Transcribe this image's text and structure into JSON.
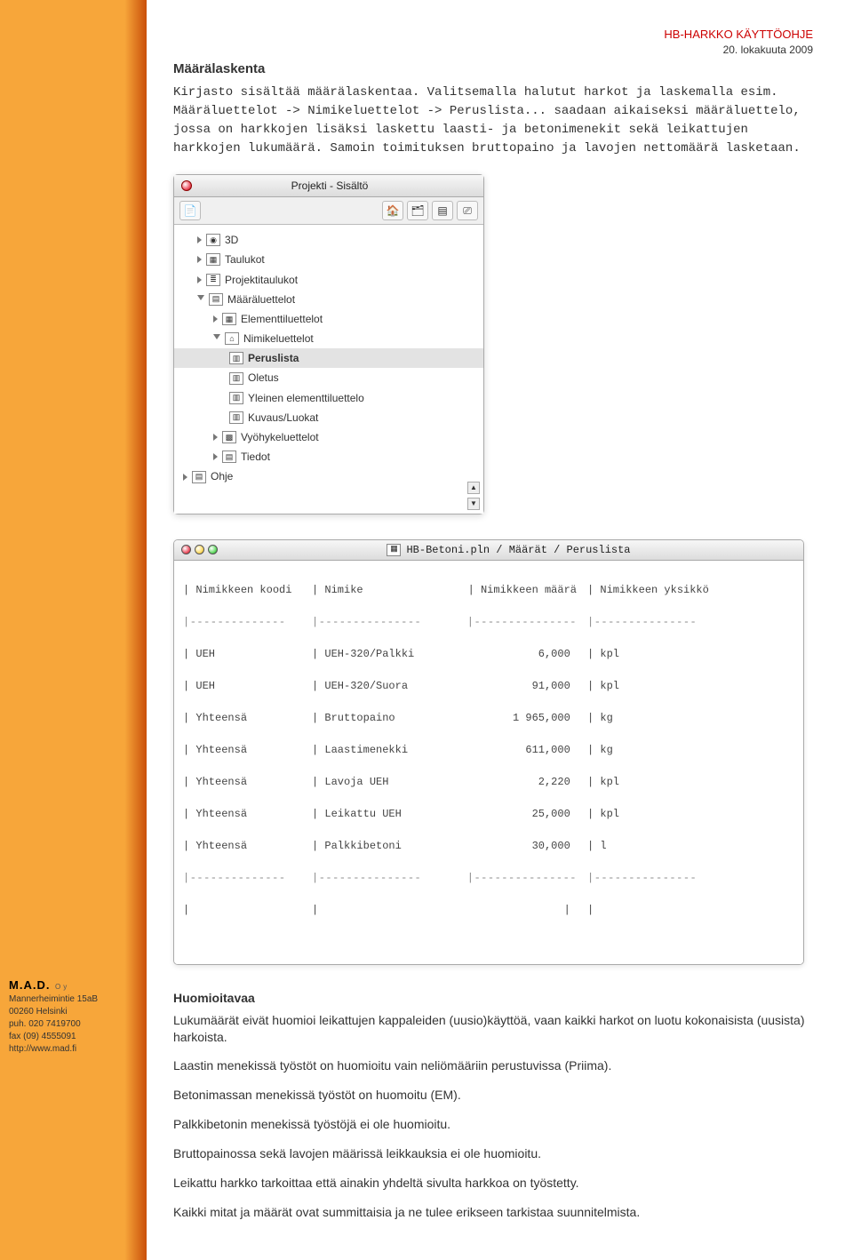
{
  "header": {
    "doc_title": "HB-HARKKO KÄYTTÖOHJE",
    "doc_date": "20. lokakuuta 2009"
  },
  "section": {
    "title": "Määrälaskenta",
    "intro": "Kirjasto sisältää määrälaskentaa. Valitsemalla halutut harkot ja laskemalla esim. Määräluettelot -> Nimikeluettelot -> Peruslista... saadaan aikaiseksi määräluettelo, jossa on harkkojen lisäksi laskettu laasti- ja betonimenekit sekä leikattujen harkkojen lukumäärä. Samoin toimituksen bruttopaino ja lavojen nettomäärä lasketaan."
  },
  "palette": {
    "title": "Projekti - Sisältö",
    "items": {
      "i0": "3D",
      "i1": "Taulukot",
      "i2": "Projektitaulukot",
      "i3": "Määräluettelot",
      "i4": "Elementtiluettelot",
      "i5": "Nimikeluettelot",
      "i6": "Peruslista",
      "i7": "Oletus",
      "i8": "Yleinen elementtiluettelo",
      "i9": "Kuvaus/Luokat",
      "i10": "Vyöhykeluettelot",
      "i11": "Tiedot",
      "i12": "Ohje"
    }
  },
  "listwin": {
    "title": "HB-Betoni.pln / Määrät / Peruslista",
    "cols": {
      "c1": "Nimikkeen koodi",
      "c2": "Nimike",
      "c3": "Nimikkeen määrä",
      "c4": "Nimikkeen yksikkö"
    },
    "rows": [
      {
        "c1": "UEH",
        "c2": "UEH-320/Palkki",
        "c3": "6,000",
        "c4": "kpl"
      },
      {
        "c1": "UEH",
        "c2": "UEH-320/Suora",
        "c3": "91,000",
        "c4": "kpl"
      },
      {
        "c1": "Yhteensä",
        "c2": "Bruttopaino",
        "c3": "1 965,000",
        "c4": "kg"
      },
      {
        "c1": "Yhteensä",
        "c2": "Laastimenekki",
        "c3": "611,000",
        "c4": "kg"
      },
      {
        "c1": "Yhteensä",
        "c2": "Lavoja UEH",
        "c3": "2,220",
        "c4": "kpl"
      },
      {
        "c1": "Yhteensä",
        "c2": "Leikattu UEH",
        "c3": "25,000",
        "c4": "kpl"
      },
      {
        "c1": "Yhteensä",
        "c2": "Palkkibetoni",
        "c3": "30,000",
        "c4": "l"
      }
    ]
  },
  "notes": {
    "title": "Huomioitavaa",
    "p1": "Lukumäärät eivät huomioi leikattujen kappaleiden (uusio)käyttöä, vaan kaikki harkot on luotu kokonaisista (uusista) harkoista.",
    "p2": "Laastin menekissä työstöt on huomioitu vain neliömääriin perustuvissa (Priima).",
    "p3": "Betonimassan menekissä työstöt on huomoitu (EM).",
    "p4": "Palkkibetonin menekissä työstöjä ei ole huomioitu.",
    "p5": "Bruttopainossa sekä lavojen määrissä leikkauksia ei ole huomioitu.",
    "p6": "Leikattu harkko tarkoittaa että ainakin yhdeltä sivulta harkkoa on työstetty.",
    "p7": "Kaikki mitat ja määrät ovat summittaisia ja ne tulee erikseen tarkistaa suunnitelmista."
  },
  "leftbar": {
    "company": "M.A.D.",
    "oy": "Oy",
    "addr1": "Mannerheimintie 15aB",
    "addr2": "00260 Helsinki",
    "tel": "puh. 020 7419700",
    "fax": "fax   (09) 4555091",
    "url": "http://www.mad.fi"
  }
}
